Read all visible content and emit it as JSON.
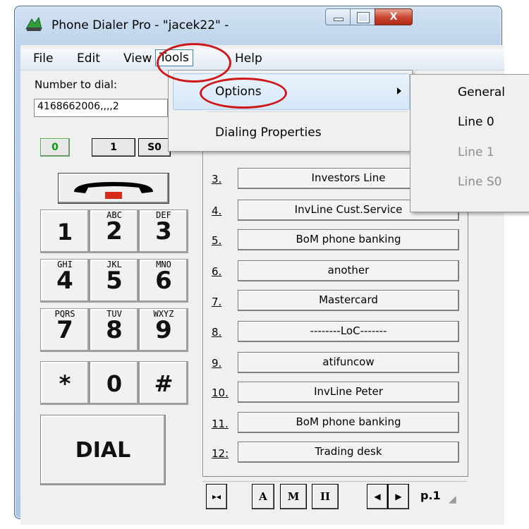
{
  "window": {
    "title": "Phone Dialer Pro - \"jacek22\" -",
    "close_glyph": "X"
  },
  "menubar": {
    "items": [
      "File",
      "Edit",
      "View",
      "Tools",
      "Help"
    ]
  },
  "dial": {
    "label": "Number to dial:",
    "value": "4168662006,,,,2"
  },
  "lines": [
    "0",
    "1",
    "S0"
  ],
  "keypad": [
    {
      "main": "1",
      "sub": ""
    },
    {
      "main": "2",
      "sub": "ABC"
    },
    {
      "main": "3",
      "sub": "DEF"
    },
    {
      "main": "4",
      "sub": "GHI"
    },
    {
      "main": "5",
      "sub": "JKL"
    },
    {
      "main": "6",
      "sub": "MNO"
    },
    {
      "main": "7",
      "sub": "PQRS"
    },
    {
      "main": "8",
      "sub": "TUV"
    },
    {
      "main": "9",
      "sub": "WXYZ"
    },
    {
      "main": "*",
      "sub": ""
    },
    {
      "main": "0",
      "sub": ""
    },
    {
      "main": "#",
      "sub": ""
    }
  ],
  "dial_button": "DIAL",
  "speed_dials": [
    {
      "num": "3.",
      "label": "Investors Line"
    },
    {
      "num": "4.",
      "label": "InvLine Cust.Service"
    },
    {
      "num": "5.",
      "label": "BoM phone banking"
    },
    {
      "num": "6.",
      "label": "another"
    },
    {
      "num": "7.",
      "label": "Mastercard"
    },
    {
      "num": "8.",
      "label": "--------LoC-------"
    },
    {
      "num": "9.",
      "label": "atifuncow"
    },
    {
      "num": "10.",
      "label": "InvLine Peter"
    },
    {
      "num": "11.",
      "label": "BoM phone banking"
    },
    {
      "num": "12:",
      "label": "Trading desk"
    }
  ],
  "toolbar": {
    "buttons": [
      "A",
      "M",
      "II"
    ],
    "page": "p.1"
  },
  "tools_menu": {
    "items": [
      "Options",
      "Dialing Properties"
    ]
  },
  "options_submenu": {
    "items": [
      "General",
      "Line 0",
      "Line 1",
      "Line S0"
    ],
    "disabled_color": "#8d8d8d"
  },
  "colors": {
    "annotation": "#d01818",
    "line0_text": "#0a9a12"
  }
}
